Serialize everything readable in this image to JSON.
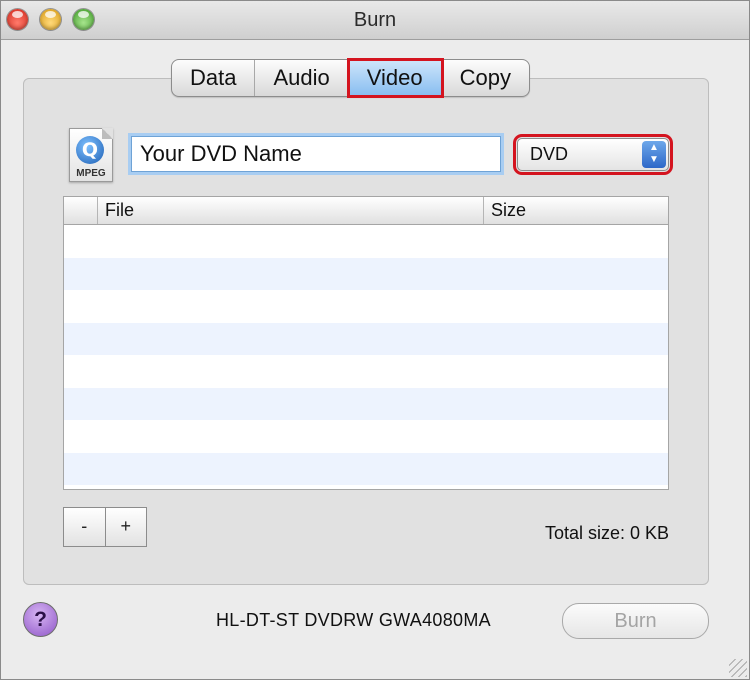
{
  "window": {
    "title": "Burn"
  },
  "tabs": [
    {
      "label": "Data"
    },
    {
      "label": "Audio"
    },
    {
      "label": "Video",
      "active": true
    },
    {
      "label": "Copy"
    }
  ],
  "disc": {
    "icon": "mpeg-file-icon",
    "icon_label": "MPEG",
    "name_value": "Your DVD Name",
    "format_selected": "DVD"
  },
  "table": {
    "columns": [
      "File",
      "Size"
    ],
    "rows": []
  },
  "buttons": {
    "remove": "-",
    "add": "+",
    "burn": "Burn",
    "help": "?"
  },
  "total_size": "Total size: 0 KB",
  "drive": "HL-DT-ST DVDRW GWA4080MA",
  "colors": {
    "highlight": "#d4141f",
    "selected_tab": "#87bdf0",
    "alt_row": "#edf3fe"
  }
}
